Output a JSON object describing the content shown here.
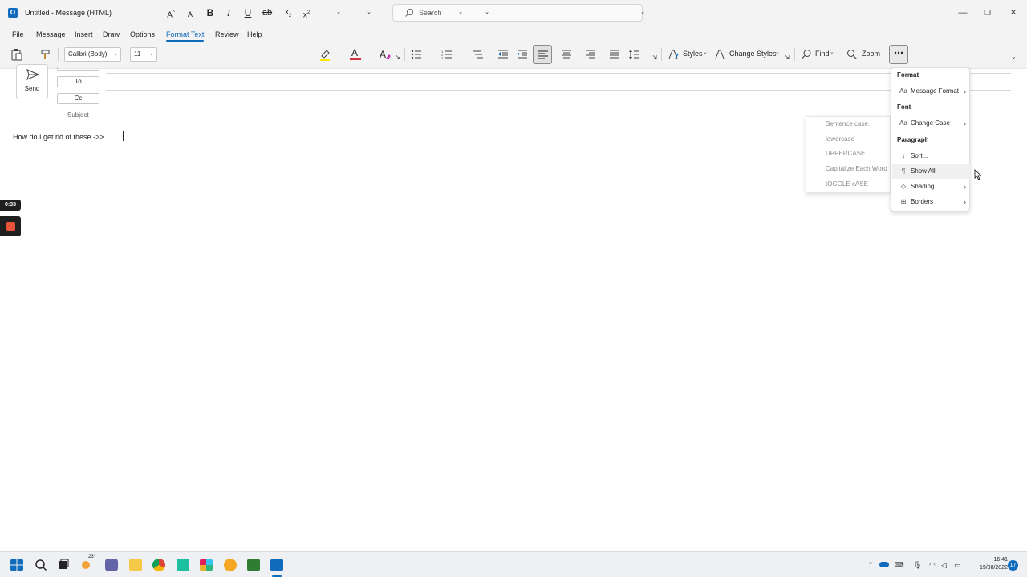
{
  "window": {
    "title": "Untitled  -  Message (HTML)",
    "search_placeholder": "Search",
    "minimize": "—",
    "restore": "❐",
    "close": "✕"
  },
  "tabs": [
    {
      "label": "File"
    },
    {
      "label": "Message"
    },
    {
      "label": "Insert"
    },
    {
      "label": "Draw"
    },
    {
      "label": "Options"
    },
    {
      "label": "Format Text"
    },
    {
      "label": "Review"
    },
    {
      "label": "Help"
    }
  ],
  "active_tab": "Format Text",
  "ribbon": {
    "font_name": "Calibri (Body)",
    "font_size": "11",
    "styles_label": "Styles",
    "change_styles_label": "Change Styles",
    "find_label": "Find",
    "zoom_label": "Zoom",
    "more_label": "⋯"
  },
  "compose": {
    "send_label": "Send",
    "to_label": "To",
    "cc_label": "Cc",
    "subject_label": "Subject",
    "body_text": "How do I get rid of these  ->>"
  },
  "recording": {
    "time": "0:33"
  },
  "dropdown": {
    "format_header": "Format",
    "message_format": "Message Format",
    "font_header": "Font",
    "change_case": "Change Case",
    "paragraph_header": "Paragraph",
    "sort": "Sort...",
    "show_all": "Show All",
    "shading": "Shading",
    "borders": "Borders"
  },
  "submenu": {
    "items": [
      "Sentence case.",
      "lowercase",
      "UPPERCASE",
      "Capitalize Each Word",
      "tOGGLE cASE"
    ]
  },
  "taskbar": {
    "weather_temp": "23°",
    "time": "16:41",
    "date": "19/08/2022",
    "notification_count": "17"
  },
  "colors": {
    "accent": "#0f6cbd",
    "highlight_yellow": "#ffe600",
    "font_color_red": "#d13438",
    "record_red": "#e8553b"
  }
}
